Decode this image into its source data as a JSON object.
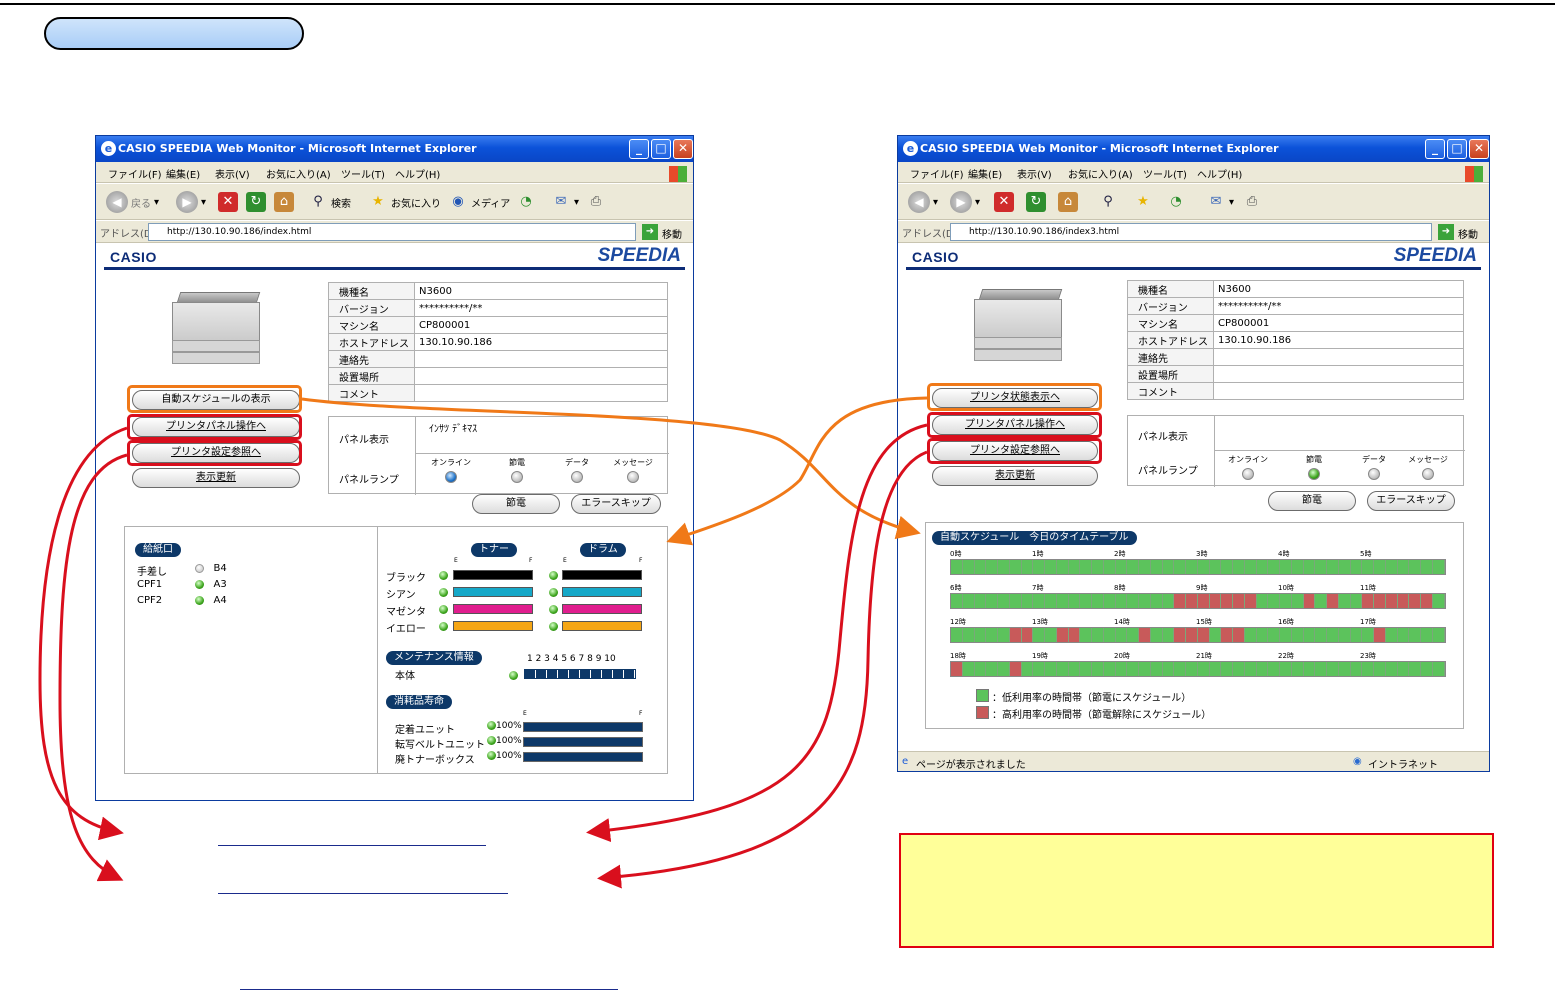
{
  "colors": {
    "orange": "#f07918",
    "red": "#d90f1d",
    "navy": "#0d3868",
    "schedule_low": "#5cc35c",
    "schedule_high": "#c85a5a",
    "note_bg": "#ffff99"
  },
  "browser": {
    "title": "CASIO SPEEDIA Web Monitor - Microsoft Internet Explorer",
    "menu": [
      "ファイル(F)",
      "編集(E)",
      "表示(V)",
      "お気に入り(A)",
      "ツール(T)",
      "ヘルプ(H)"
    ],
    "toolbar": {
      "back": "戻る",
      "search": "検索",
      "favorites": "お気に入り",
      "media": "メディア"
    },
    "address_label": "アドレス(D)",
    "go": "移動"
  },
  "brand": {
    "casio": "CASIO",
    "speedia": "SPEEDIA"
  },
  "left_window": {
    "url": "http://130.10.90.186/index.html",
    "info": [
      [
        "機種名",
        "N3600"
      ],
      [
        "バージョン",
        "**********/**"
      ],
      [
        "マシン名",
        "CP800001"
      ],
      [
        "ホストアドレス",
        "130.10.90.186"
      ],
      [
        "連絡先",
        ""
      ],
      [
        "設置場所",
        ""
      ],
      [
        "コメント",
        ""
      ]
    ],
    "panel_display_label": "パネル表示",
    "panel_display_value": "ｲﾝｻﾂ ﾃﾞｷﾏｽ",
    "panel_lamp_label": "パネルランプ",
    "lamps": [
      {
        "label": "オンライン",
        "state": "blue"
      },
      {
        "label": "節電",
        "state": "off"
      },
      {
        "label": "データ",
        "state": "off"
      },
      {
        "label": "メッセージ",
        "state": "off"
      }
    ],
    "buttons": {
      "schedule": "自動スケジュールの表示",
      "panel_op": "プリンタパネル操作へ",
      "settings": "プリンタ設定参照へ",
      "refresh": "表示更新",
      "power_save": "節電",
      "error_skip": "エラースキップ"
    },
    "paper": {
      "title": "給紙口",
      "rows": [
        {
          "name": "手差し",
          "size": "B4",
          "state": "off"
        },
        {
          "name": "CPF1",
          "size": "A3",
          "state": "on"
        },
        {
          "name": "CPF2",
          "size": "A4",
          "state": "on"
        }
      ]
    },
    "consumables": {
      "toner_title": "トナー",
      "drum_title": "ドラム",
      "e": "E",
      "f": "F",
      "rows": [
        {
          "name": "ブラック",
          "color": "#000000"
        },
        {
          "name": "シアン",
          "color": "#15a8c8"
        },
        {
          "name": "マゼンタ",
          "color": "#e01e8e"
        },
        {
          "name": "イエロー",
          "color": "#f5a615"
        }
      ]
    },
    "maintenance": {
      "title": "メンテナンス情報",
      "scale": "1 2 3 4 5 6 7 8 9 10",
      "item": "本体"
    },
    "life": {
      "title": "消耗品寿命",
      "e": "E",
      "f": "F",
      "rows": [
        {
          "name": "定着ユニット",
          "percent": "100%"
        },
        {
          "name": "転写ベルトユニット",
          "percent": "100%"
        },
        {
          "name": "廃トナーボックス",
          "percent": "100%"
        }
      ]
    }
  },
  "right_window": {
    "url": "http://130.10.90.186/index3.html",
    "info": [
      [
        "機種名",
        "N3600"
      ],
      [
        "バージョン",
        "**********/**"
      ],
      [
        "マシン名",
        "CP800001"
      ],
      [
        "ホストアドレス",
        "130.10.90.186"
      ],
      [
        "連絡先",
        ""
      ],
      [
        "設置場所",
        ""
      ],
      [
        "コメント",
        ""
      ]
    ],
    "panel_display_label": "パネル表示",
    "panel_lamp_label": "パネルランプ",
    "lamps": [
      {
        "label": "オンライン",
        "state": "off"
      },
      {
        "label": "節電",
        "state": "green"
      },
      {
        "label": "データ",
        "state": "off"
      },
      {
        "label": "メッセージ",
        "state": "off"
      }
    ],
    "buttons": {
      "status": "プリンタ状態表示へ",
      "panel_op": "プリンタパネル操作へ",
      "settings": "プリンタ設定参照へ",
      "refresh": "表示更新",
      "power_save": "節電",
      "error_skip": "エラースキップ"
    },
    "schedule": {
      "title": "自動スケジュール　今日のタイムテーブル",
      "rows": [
        {
          "hours": [
            "0時",
            "1時",
            "2時",
            "3時",
            "4時",
            "5時"
          ],
          "high": []
        },
        {
          "hours": [
            "6時",
            "7時",
            "8時",
            "9時",
            "10時",
            "11時"
          ],
          "high": [
            19,
            20,
            21,
            22,
            23,
            24,
            25,
            30,
            32,
            35,
            36,
            37,
            38,
            39,
            40
          ]
        },
        {
          "hours": [
            "12時",
            "13時",
            "14時",
            "15時",
            "16時",
            "17時"
          ],
          "high": [
            5,
            6,
            9,
            10,
            16,
            19,
            20,
            21,
            23,
            24,
            36
          ]
        },
        {
          "hours": [
            "18時",
            "19時",
            "20時",
            "21時",
            "22時",
            "23時"
          ],
          "high": [
            0,
            5
          ]
        }
      ],
      "legend_low": "：低利用率の時間帯（節電にスケジュール）",
      "legend_high": "：高利用率の時間帯（節電解除にスケジュール）"
    },
    "status_text": "ページが表示されました",
    "zone": "イントラネット"
  }
}
